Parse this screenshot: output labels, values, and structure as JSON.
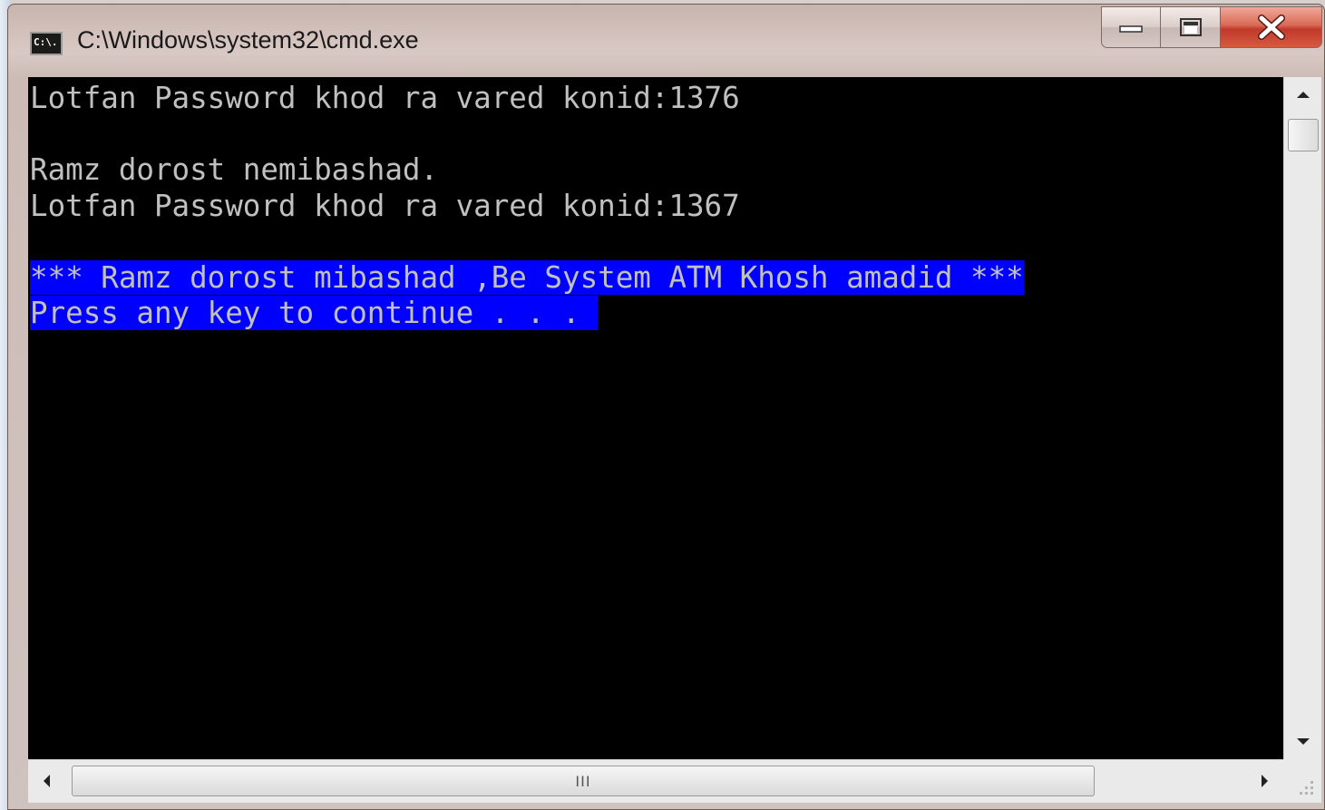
{
  "window": {
    "title": "C:\\Windows\\system32\\cmd.exe",
    "icon": "cmd-console-icon",
    "icon_text": "C:\\."
  },
  "caption_buttons": {
    "minimize_icon": "minimize-icon",
    "maximize_icon": "maximize-icon",
    "close_icon": "close-icon"
  },
  "console": {
    "lines": [
      "Lotfan Password khod ra vared konid:1376",
      "",
      "Ramz dorost nemibashad.",
      "Lotfan Password khod ra vared konid:1367",
      "",
      "*** Ramz dorost mibashad ,Be System ATM Khosh amadid ***",
      "Press any key to continue . . . "
    ],
    "selection_color": "#0000ff",
    "text_color": "#c0c0c0",
    "background_color": "#000000"
  },
  "scrollbars": {
    "horizontal_grip": "III"
  }
}
